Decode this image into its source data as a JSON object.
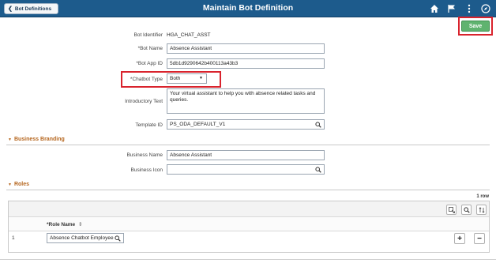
{
  "topbar": {
    "back_label": "Bot Definitions",
    "title": "Maintain Bot Definition",
    "icons": [
      "home-icon",
      "flag-icon",
      "more-vertical-icon",
      "compass-icon"
    ]
  },
  "actions": {
    "save_label": "Save"
  },
  "form": {
    "bot_identifier_label": "Bot Identifier",
    "bot_identifier_value": "HGA_CHAT_ASST",
    "bot_name_label": "*Bot Name",
    "bot_name_value": "Absence Assistant",
    "bot_app_id_label": "*Bot App ID",
    "bot_app_id_value": "5db1d9290642b400113a43b3",
    "chatbot_type_label": "*Chatbot Type",
    "chatbot_type_value": "Both",
    "intro_text_label": "Introductory Text",
    "intro_text_value": "Your virtual assistant to help you with absence related tasks and queries.",
    "template_id_label": "Template ID",
    "template_id_value": "PS_ODA_DEFAULT_V1"
  },
  "business_branding": {
    "section_label": "Business Branding",
    "business_name_label": "Business Name",
    "business_name_value": "Absence Assistant",
    "business_icon_label": "Business Icon",
    "business_icon_value": ""
  },
  "roles": {
    "section_label": "Roles",
    "row_count": "1 row",
    "column_header": "*Role Name",
    "rows": [
      {
        "number": "1",
        "role_name": "Absence Chatbot Employee"
      }
    ]
  },
  "colors": {
    "topbar": "#1d5b8c",
    "save": "#5fb36f",
    "section": "#b5651d",
    "highlight": "#d9232d"
  }
}
